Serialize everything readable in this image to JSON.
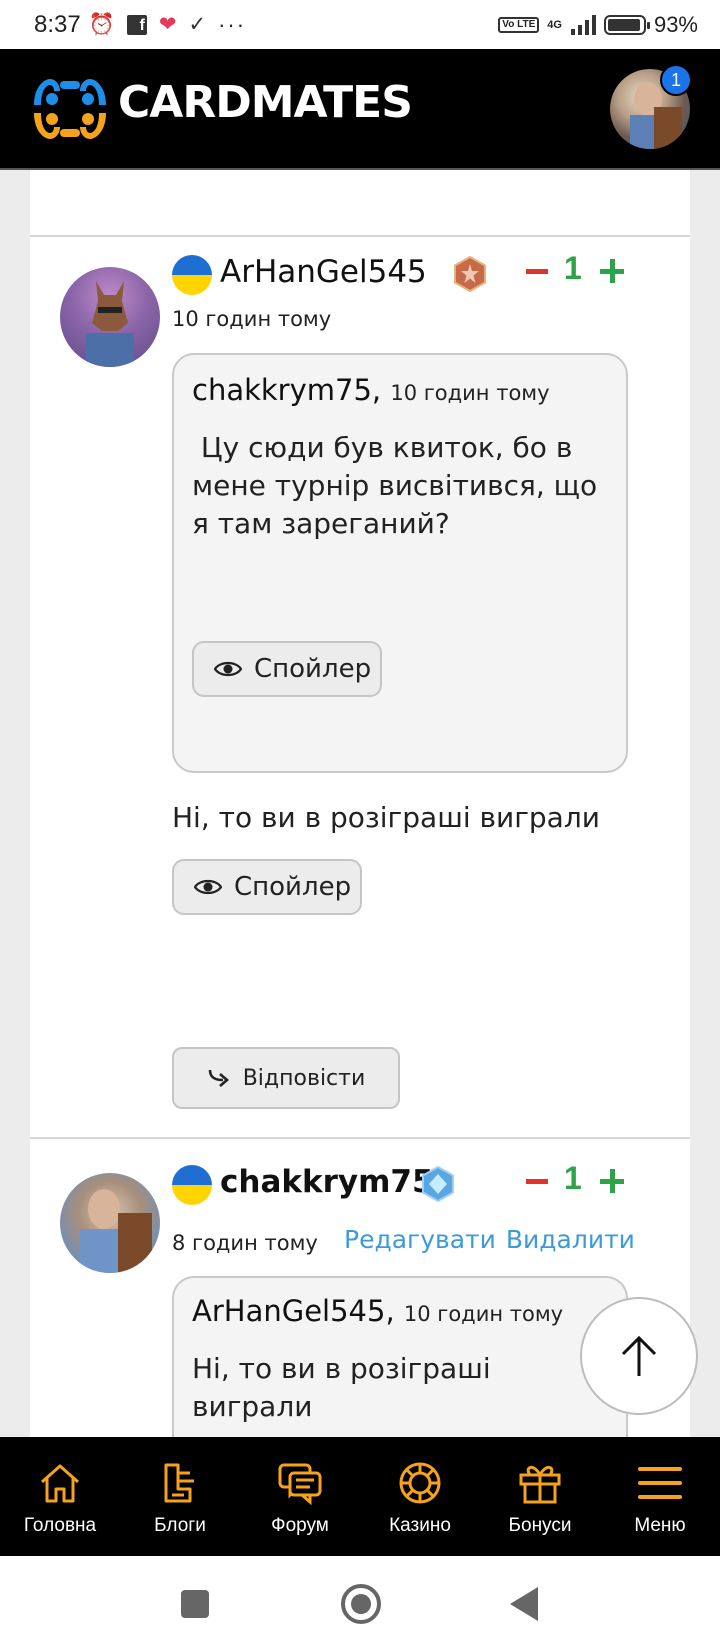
{
  "status_bar": {
    "time": "8:37",
    "battery": "93%",
    "network": "4G",
    "volte": "Vo LTE",
    "battery_level": 0.93
  },
  "header": {
    "brand": "CARDMATES",
    "notification_count": "1",
    "brand_colors": {
      "blue": "#1e8fe8",
      "orange": "#f5a31a"
    }
  },
  "comments": [
    {
      "author": "ArHanGel545",
      "time": "10 годин тому",
      "votes": "1",
      "quote": {
        "author": "chakkrym75",
        "time": "10 годин тому",
        "text": " Цу сюди був квиток, бо в мене турнір висвітився, що я там зареганий?",
        "spoiler_label": "Спойлер"
      },
      "text": "Ні, то ви в розіграші виграли",
      "spoiler_label": "Спойлер",
      "reply_label": "Відповісти"
    },
    {
      "author": "chakkrym75",
      "time": "8 годин тому",
      "votes": "1",
      "edit_label": "Редагувати",
      "delete_label": "Видалити",
      "quote": {
        "author": "ArHanGel545",
        "time": "10 годин тому",
        "text": "Ні, то ви в розіграші виграли"
      }
    }
  ],
  "bottom_nav": [
    {
      "label": "Головна",
      "icon": "home-icon"
    },
    {
      "label": "Блоги",
      "icon": "blogs-icon"
    },
    {
      "label": "Форум",
      "icon": "forum-icon"
    },
    {
      "label": "Казино",
      "icon": "casino-icon"
    },
    {
      "label": "Бонуси",
      "icon": "gift-icon"
    },
    {
      "label": "Меню",
      "icon": "menu-icon"
    }
  ],
  "colors": {
    "accent_orange": "#f5a31a",
    "vote_minus": "#e0342a",
    "vote_plus": "#2ea34a",
    "link_blue": "#3d9ad8"
  }
}
